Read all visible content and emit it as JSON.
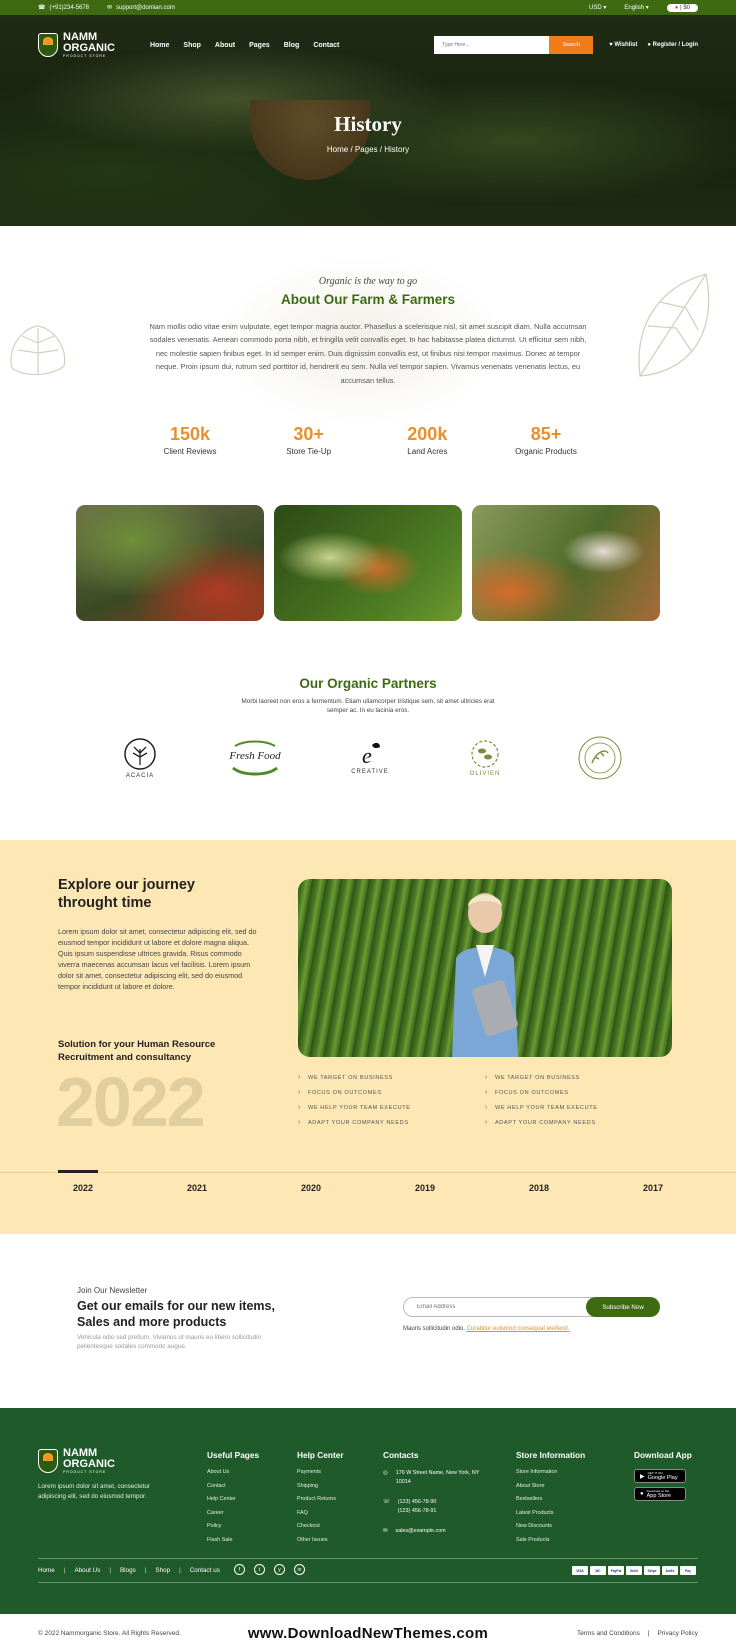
{
  "topbar": {
    "phone": "(+91)234-5678",
    "email": "support@domian.com",
    "currency": "USD",
    "language": "English",
    "cart_count": "$0"
  },
  "brand": {
    "name_line1": "NAMM",
    "name_line2": "ORGANIC",
    "tagline": "PRODUCT STORE"
  },
  "nav": {
    "items": [
      "Home",
      "Shop",
      "About",
      "Pages",
      "Blog",
      "Contact"
    ],
    "search_placeholder": "Type Here...",
    "search_button": "Search",
    "wishlist": "Wishlist",
    "account": "Register / Login"
  },
  "hero": {
    "title": "History",
    "breadcrumb": "Home / Pages / History"
  },
  "about": {
    "tagline": "Organic is the way to go",
    "title": "About Our Farm & Farmers",
    "text": "Nam mollis odio vitae enim vulputate, eget tempor magna auctor. Phasellus a scelerisque nisl, sit amet suscipit diam. Nulla accumsan sodales venenatis. Aenean commodo porta nibh, et fringilla velit convallis eget. In hac habitasse platea dictumst. Ut efficitur sem nibh, nec molestie sapien finibus eget. In id semper enim. Duis dignissim convallis est, ut finibus nisi tempor maximus. Donec at tempor neque. Proin ipsum dui, rutrum sed porttitor id, hendrerit eu sem. Nulla vel tempor sapien. Vivamus venenatis venenatis lectus, eu accumsan tellus.",
    "stats": [
      {
        "value": "150k",
        "label": "Client Reviews"
      },
      {
        "value": "30+",
        "label": "Store Tie-Up"
      },
      {
        "value": "200k",
        "label": "Land Acres"
      },
      {
        "value": "85+",
        "label": "Organic Products"
      }
    ]
  },
  "partners": {
    "title": "Our Organic Partners",
    "text": "Morbi laoreet non eros a fermentum. Etiam ullamcorper tristique sem, sit amet ultricies erat semper ac. In eu lacinia eros.",
    "logos": [
      "ACACIA",
      "Fresh Food",
      "CREATIVE",
      "OLIVIEN",
      ""
    ]
  },
  "journey": {
    "title": "Explore our journey throught time",
    "text": "Lorem ipsum dolor sit amet, consectetur adipiscing elit, sed do eiusmod tempor incididunt ut labore et dolore magna aliqua. Quis ipsum suspendisse ultrices gravida. Risus commodo viverra maecenas accumsan lacus vel facilisis. Lorem ipsum dolor sit amet, consectetur adipiscing elit, sed do eiusmod tempor incididunt ut labore et dolore.",
    "subtitle": "Solution for your Human Resource Recruitment and consultancy",
    "big_year": "2022",
    "checks": [
      "WE TARGET ON BUSINESS",
      "WE TARGET ON BUSINESS",
      "FOCUS ON OUTCOMES",
      "FOCUS ON OUTCOMES",
      "WE HELP YOUR TEAM  EXECUTE",
      "WE HELP YOUR TEAM  EXECUTE",
      "ADAPT YOUR COMPANY NEEDS",
      "ADAPT YOUR COMPANY NEEDS"
    ],
    "years": [
      "2022",
      "2021",
      "2020",
      "2019",
      "2018",
      "2017"
    ],
    "active_year": "2022"
  },
  "newsletter": {
    "kicker": "Join Our Newsletter",
    "title": "Get our emails for our new items, Sales and more products",
    "desc": "Vehicula odio sed pretium. Vivamus ut mauris eu libero sollicitudin pellentesque sodales commodo augue.",
    "placeholder": "Email Address",
    "button": "Subscribe Now",
    "note": "Mauris sollicitudin odio.",
    "note_link": "Curabitur euismod consequat eleifend."
  },
  "footer": {
    "about": "Lorem ipsum dolor sit amet, consectetur adipiscing elit, sed do eiusmod tempor.",
    "useful": {
      "title": "Useful Pages",
      "items": [
        "About Us",
        "Contact",
        "Help Center",
        "Career",
        "Policy",
        "Flash Sale"
      ]
    },
    "help": {
      "title": "Help Center",
      "items": [
        "Payments",
        "Shipping",
        "Product Returns",
        "FAQ",
        "Checkout",
        "Other Issues"
      ]
    },
    "contacts": {
      "title": "Contacts",
      "address": "176 W Street Name, New York, NY 10014",
      "phones": "(123) 456-78-90\n(123) 456-78-91",
      "email": "sales@example.com"
    },
    "store": {
      "title": "Store Information",
      "items": [
        "Store Information",
        "About  Store",
        "Bestsellers",
        "Latest Products",
        "New Discounts",
        "Sale Products"
      ]
    },
    "app": {
      "title": "Download App",
      "google_small": "GET IT ON",
      "google": "Google Play",
      "apple_small": "Download on the",
      "apple": "App Store"
    },
    "links": [
      "Home",
      "About Us",
      "Blogs",
      "Shop",
      "Contact us"
    ],
    "social": [
      "f",
      "t",
      "y",
      "in"
    ],
    "payments": [
      "VISA",
      "MC",
      "PayPal",
      "Skrill",
      "Stripe",
      "AmEx",
      "Pay"
    ],
    "copyright": "© 2022 Nammorganic Store. All Rights Reserved.",
    "watermark": "www.DownloadNewThemes.com",
    "terms": "Terms and Conditions",
    "privacy": "Privacy Policy"
  }
}
